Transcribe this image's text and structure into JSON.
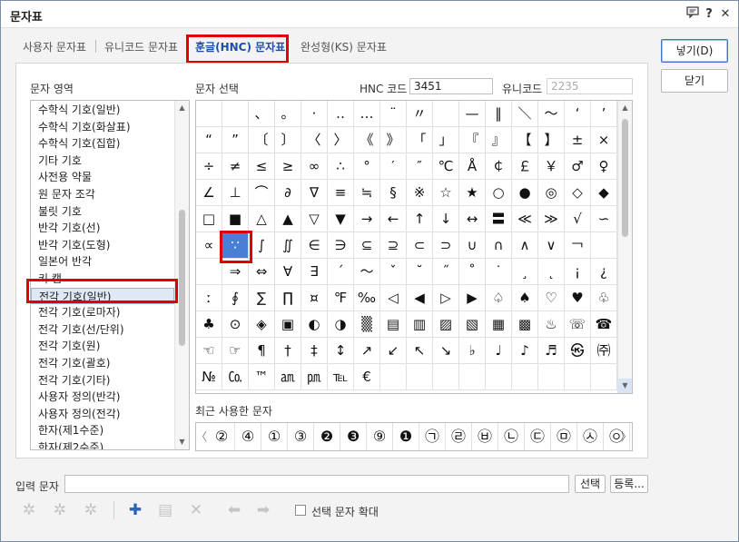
{
  "window": {
    "title": "문자표",
    "buttons": {
      "feedback_icon": "speech-bubble-icon",
      "help": "?",
      "close": "✕"
    }
  },
  "tabs": [
    {
      "label": "사용자 문자표",
      "active": false
    },
    {
      "label": "유니코드 문자표",
      "active": false
    },
    {
      "label": "훈글(HNC) 문자표",
      "active": true
    },
    {
      "label": "완성형(KS) 문자표",
      "active": false
    }
  ],
  "side_buttons": {
    "insert": "넣기(D)",
    "close": "닫기"
  },
  "area": {
    "label": "문자 영역",
    "items": [
      "수학식 기호(일반)",
      "수학식 기호(화살표)",
      "수학식 기호(집합)",
      "기타 기호",
      "사전용 약물",
      "원 문자 조각",
      "불릿 기호",
      "반각 기호(선)",
      "반각 기호(도형)",
      "일본어 반각",
      "키 캡",
      "전각 기호(일반)",
      "전각 기호(로마자)",
      "전각 기호(선/단위)",
      "전각 기호(원)",
      "전각 기호(괄호)",
      "전각 기호(기타)",
      "사용자 정의(반각)",
      "사용자 정의(전각)",
      "한자(제1수준)",
      "한자(제2수준)"
    ],
    "selected_index": 11
  },
  "select": {
    "label": "문자 선택",
    "hnc_code_label": "HNC 코드",
    "hnc_code_value": "3451",
    "unicode_label": "유니코드",
    "unicode_value": "2235"
  },
  "grid": {
    "rows": [
      [
        " ",
        " ",
        "、",
        "。",
        "·",
        "‥",
        "…",
        "¨",
        "〃",
        " ",
        "—",
        "‖",
        "＼",
        "～",
        "‘",
        "’"
      ],
      [
        "“",
        "”",
        "〔",
        "〕",
        "〈",
        "〉",
        "《",
        "》",
        "「",
        "」",
        "『",
        "』",
        "【",
        "】",
        "±",
        "×"
      ],
      [
        "÷",
        "≠",
        "≤",
        "≥",
        "∞",
        "∴",
        "°",
        "′",
        "″",
        "℃",
        "Å",
        "￠",
        "￡",
        "￥",
        "♂",
        "♀"
      ],
      [
        "∠",
        "⊥",
        "⌒",
        "∂",
        "∇",
        "≡",
        "≒",
        "§",
        "※",
        "☆",
        "★",
        "○",
        "●",
        "◎",
        "◇",
        "◆"
      ],
      [
        "□",
        "■",
        "△",
        "▲",
        "▽",
        "▼",
        "→",
        "←",
        "↑",
        "↓",
        "↔",
        "〓",
        "≪",
        "≫",
        "√",
        "∽"
      ],
      [
        "∝",
        "∵",
        "∫",
        "∬",
        "∈",
        "∋",
        "⊆",
        "⊇",
        "⊂",
        "⊃",
        "∪",
        "∩",
        "∧",
        "∨",
        "￢",
        " "
      ],
      [
        " ",
        "⇒",
        "⇔",
        "∀",
        "∃",
        "´",
        "～",
        "ˇ",
        "˘",
        "˝",
        "˚",
        "˙",
        "¸",
        "˛",
        "¡",
        "¿"
      ],
      [
        "ː",
        "∮",
        "∑",
        "∏",
        "¤",
        "℉",
        "‰",
        "◁",
        "◀",
        "▷",
        "▶",
        "♤",
        "♠",
        "♡",
        "♥",
        "♧"
      ],
      [
        "♣",
        "⊙",
        "◈",
        "▣",
        "◐",
        "◑",
        "▒",
        "▤",
        "▥",
        "▨",
        "▧",
        "▦",
        "▩",
        "♨",
        "☏",
        "☎"
      ],
      [
        "☜",
        "☞",
        "¶",
        "†",
        "‡",
        "↕",
        "↗",
        "↙",
        "↖",
        "↘",
        "♭",
        "♩",
        "♪",
        "♬",
        "㉿",
        "㈜"
      ],
      [
        "№",
        "㏇",
        "™",
        "㏂",
        "㏘",
        "℡",
        "€",
        " ",
        " ",
        " ",
        " ",
        " ",
        " ",
        " ",
        " ",
        " "
      ]
    ],
    "selected": "∵"
  },
  "recent": {
    "label": "최근 사용한 문자",
    "items": [
      "②",
      "④",
      "①",
      "③",
      "❷",
      "❸",
      "⑨",
      "❶",
      "㉠",
      "㉣",
      "㉥",
      "㉡",
      "㉢",
      "㉤",
      "㉦",
      "㉧"
    ],
    "prev_icon": "chevron-left-icon",
    "next_icon": "chevron-right-icon"
  },
  "input": {
    "label": "입력 문자",
    "value": "",
    "select_button": "선택",
    "register_button": "등록..."
  },
  "toolbar": {
    "enlarge_label": "선택 문자 확대",
    "enlarge_checked": false
  }
}
